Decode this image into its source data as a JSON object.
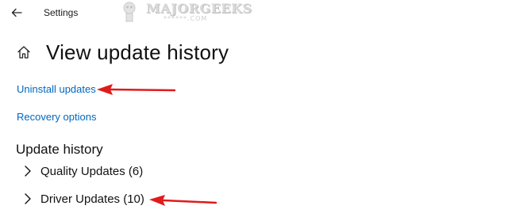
{
  "window": {
    "title": "Settings",
    "back_icon": "back-arrow-icon"
  },
  "watermark": {
    "text": "MAJORGEEKS",
    "subtext": "******.COM"
  },
  "header": {
    "title": "View update history",
    "home_icon": "home-icon"
  },
  "links": {
    "uninstall": "Uninstall updates",
    "recovery": "Recovery options"
  },
  "update_history": {
    "heading": "Update history",
    "items": [
      {
        "label": "Quality Updates (6)"
      },
      {
        "label": "Driver Updates (10)"
      }
    ]
  },
  "annotations": {
    "arrow_color": "#e01b1b"
  },
  "colors": {
    "link": "#0067c0",
    "text": "#111111",
    "background": "#ffffff"
  }
}
